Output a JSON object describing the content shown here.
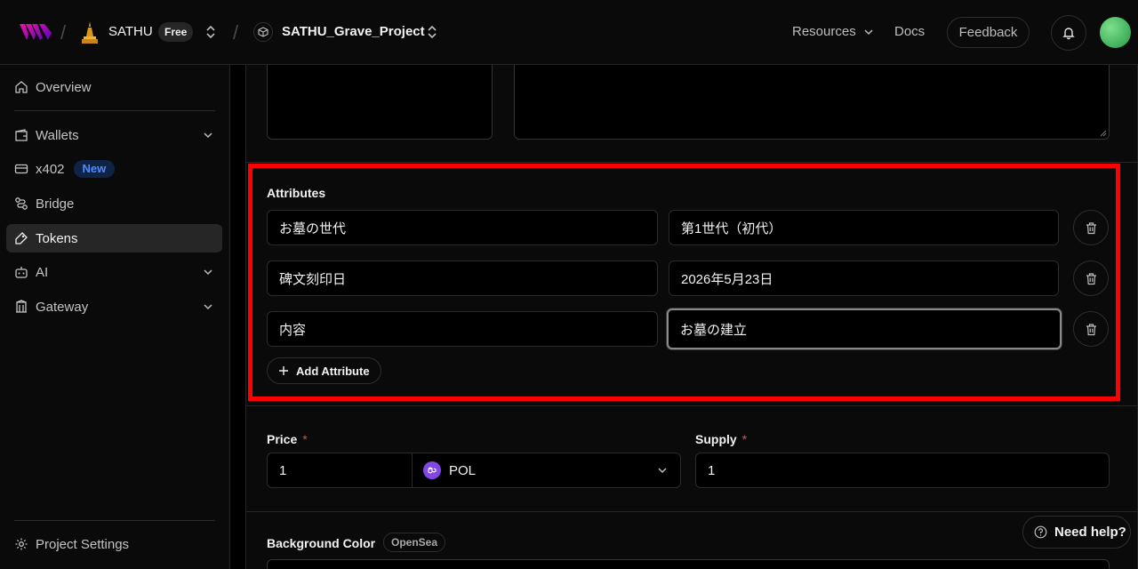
{
  "header": {
    "team_name": "SATHU",
    "plan": "Free",
    "project_name": "SATHU_Grave_Project",
    "nav": {
      "resources": "Resources",
      "docs": "Docs",
      "feedback": "Feedback"
    }
  },
  "sidebar": {
    "items": [
      {
        "label": "Overview",
        "icon": "home-icon"
      },
      {
        "label": "Wallets",
        "icon": "wallet-icon",
        "expandable": true
      },
      {
        "label": "x402",
        "icon": "card-icon",
        "badge": "New"
      },
      {
        "label": "Bridge",
        "icon": "bridge-icon"
      },
      {
        "label": "Tokens",
        "icon": "token-icon",
        "active": true
      },
      {
        "label": "AI",
        "icon": "robot-icon",
        "expandable": true
      },
      {
        "label": "Gateway",
        "icon": "gateway-icon",
        "expandable": true
      }
    ],
    "footer": {
      "label": "Project Settings",
      "icon": "settings-icon"
    }
  },
  "attributes": {
    "title": "Attributes",
    "rows": [
      {
        "key": "お墓の世代",
        "value": "第1世代（初代）"
      },
      {
        "key": "碑文刻印日",
        "value": "2026年5月23日"
      },
      {
        "key": "内容",
        "value": "お墓の建立"
      }
    ],
    "add_label": "Add Attribute"
  },
  "price": {
    "label": "Price",
    "required_mark": "*",
    "value": "1",
    "currency": "POL"
  },
  "supply": {
    "label": "Supply",
    "required_mark": "*",
    "value": "1"
  },
  "background_color": {
    "label": "Background Color",
    "badge": "OpenSea"
  },
  "help": {
    "label": "Need help?"
  },
  "colors": {
    "highlight": "#ff0000",
    "new_badge": "#4f8cf7",
    "required": "#e5484d",
    "pol": "#8247e5"
  }
}
